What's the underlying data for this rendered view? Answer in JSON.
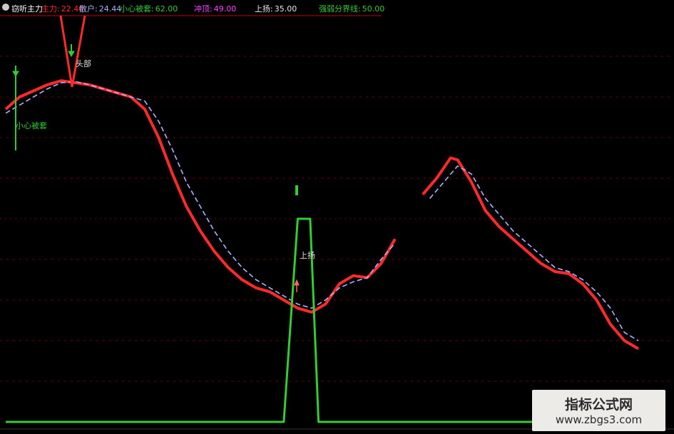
{
  "header": {
    "indicator_name": "窃听主力",
    "items": [
      {
        "label": "主力:",
        "value": "22.46",
        "color": "#ff2b2b"
      },
      {
        "label": "散户:",
        "value": "24.44",
        "color": "#a9b4ff"
      },
      {
        "label": "小心被套:",
        "value": "62.00",
        "color": "#33cc33"
      },
      {
        "label": "冲顶:",
        "value": "49.00",
        "color": "#ff44ff"
      },
      {
        "label": "上扬:",
        "value": "35.00",
        "color": "#e6e6e6"
      },
      {
        "label": "强弱分界线:",
        "value": "50.00",
        "color": "#33cc33"
      }
    ]
  },
  "chart_data": {
    "type": "line",
    "ylim": [
      0,
      100
    ],
    "grid": true,
    "series": [
      {
        "name": "主力",
        "color": "#ff2b2b",
        "values": [
          [
            0,
            77
          ],
          [
            2,
            80
          ],
          [
            4,
            81.5
          ],
          [
            6,
            83
          ],
          [
            8,
            84
          ],
          [
            10,
            83.5
          ],
          [
            12,
            83
          ],
          [
            14,
            82
          ],
          [
            16,
            81
          ],
          [
            18,
            80
          ],
          [
            20,
            77
          ],
          [
            22,
            70
          ],
          [
            24,
            61
          ],
          [
            26,
            53
          ],
          [
            28,
            47
          ],
          [
            30,
            42
          ],
          [
            32,
            38
          ],
          [
            34,
            35
          ],
          [
            36,
            33
          ],
          [
            38,
            32
          ],
          [
            40,
            30
          ],
          [
            42,
            28
          ],
          [
            44,
            27
          ],
          [
            46,
            29
          ],
          [
            48,
            34
          ],
          [
            50,
            36
          ],
          [
            52,
            35.5
          ],
          [
            54,
            39
          ],
          [
            56,
            45
          ],
          null,
          [
            60,
            56
          ],
          [
            62,
            60
          ],
          [
            64,
            65
          ],
          [
            65,
            64.5
          ],
          [
            67,
            59
          ],
          [
            69,
            52
          ],
          [
            71,
            48
          ],
          [
            73,
            45
          ],
          [
            75,
            42
          ],
          [
            77,
            39
          ],
          [
            79,
            37
          ],
          [
            81,
            36.5
          ],
          [
            83,
            34
          ],
          [
            85,
            30
          ],
          [
            87,
            24
          ],
          [
            89,
            20
          ],
          [
            91,
            18
          ]
        ]
      },
      {
        "name": "散户",
        "color": "#a9b4ff",
        "values": [
          [
            0,
            76
          ],
          [
            2,
            78
          ],
          [
            4,
            80
          ],
          [
            6,
            82
          ],
          [
            8,
            83.5
          ],
          [
            10,
            83.8
          ],
          [
            12,
            83
          ],
          [
            14,
            82
          ],
          [
            16,
            81
          ],
          [
            18,
            80
          ],
          [
            20,
            79
          ],
          [
            22,
            74
          ],
          [
            24,
            67
          ],
          [
            26,
            59
          ],
          [
            28,
            53
          ],
          [
            30,
            47
          ],
          [
            32,
            42
          ],
          [
            34,
            38
          ],
          [
            36,
            35
          ],
          [
            38,
            33
          ],
          [
            40,
            31
          ],
          [
            42,
            29
          ],
          [
            44,
            28
          ],
          [
            46,
            30
          ],
          [
            48,
            33
          ],
          [
            50,
            34.5
          ],
          [
            52,
            35.5
          ],
          [
            54,
            40
          ],
          [
            56,
            44
          ],
          null,
          [
            61,
            55
          ],
          [
            63,
            59
          ],
          [
            65,
            63
          ],
          [
            67,
            61
          ],
          [
            69,
            55
          ],
          [
            71,
            51
          ],
          [
            73,
            47
          ],
          [
            75,
            44
          ],
          [
            77,
            41
          ],
          [
            79,
            38
          ],
          [
            81,
            37
          ],
          [
            83,
            35
          ],
          [
            85,
            32
          ],
          [
            87,
            28
          ],
          [
            89,
            22
          ],
          [
            91,
            20
          ]
        ]
      },
      {
        "name": "小心被套",
        "color": "#33cc33",
        "values": [
          [
            0,
            0
          ],
          [
            38,
            0
          ],
          [
            40,
            0
          ],
          [
            42,
            50
          ],
          [
            43,
            50
          ],
          [
            43.8,
            50
          ],
          [
            45,
            0
          ],
          [
            60,
            0
          ],
          [
            77,
            0
          ]
        ]
      }
    ],
    "annotations": [
      {
        "text": "头部",
        "x": 10,
        "y": 85,
        "color": "#e0e0e0"
      },
      {
        "text": "小心被套",
        "x": 2,
        "y": 70,
        "color": "#33cc33"
      },
      {
        "text": "上扬",
        "x": 43.5,
        "y": 38,
        "color": "#e0e0e0"
      }
    ]
  },
  "watermark": {
    "title": "指标公式网",
    "url": "www.zbgs3.com"
  }
}
